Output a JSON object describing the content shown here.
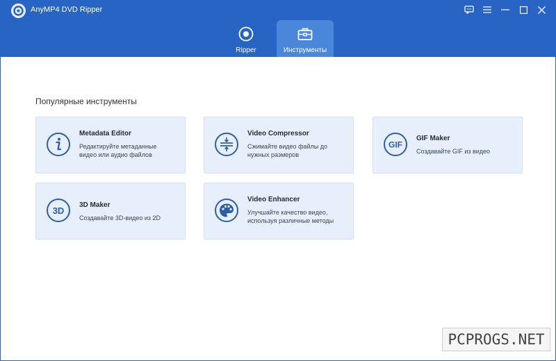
{
  "window": {
    "title": "AnyMP4 DVD Ripper",
    "controls": [
      "feedback-icon",
      "menu-icon",
      "minimize-icon",
      "maximize-icon",
      "close-icon"
    ]
  },
  "tabs": [
    {
      "label": "Ripper",
      "icon": "disc-icon",
      "active": false
    },
    {
      "label": "Инструменты",
      "icon": "toolbox-icon",
      "active": true
    }
  ],
  "main": {
    "section_title": "Популярные инструменты",
    "tools": [
      {
        "title": "Metadata Editor",
        "desc": "Редактируйте метаданные\nвидео или аудио файлов",
        "icon": "info-icon"
      },
      {
        "title": "Video Compressor",
        "desc": "Сжимайте видео файлы до\nнужных размеров",
        "icon": "compress-icon"
      },
      {
        "title": "GIF Maker",
        "desc": "Создавайте GIF из видео",
        "icon": "gif-icon",
        "icon_text": "GIF"
      },
      {
        "title": "3D Maker",
        "desc": "Создавайте 3D-видео из 2D",
        "icon": "3d-icon",
        "icon_text": "3D"
      },
      {
        "title": "Video Enhancer",
        "desc": "Улучшайте качество видео,\nиспользуя различные методы",
        "icon": "palette-icon"
      }
    ]
  },
  "watermark": "PCPROGS.NET",
  "colors": {
    "header": "#2764c4",
    "active_tab": "#4a87da",
    "card_bg": "#e6effb",
    "icon_stroke": "#2c5ea8"
  }
}
